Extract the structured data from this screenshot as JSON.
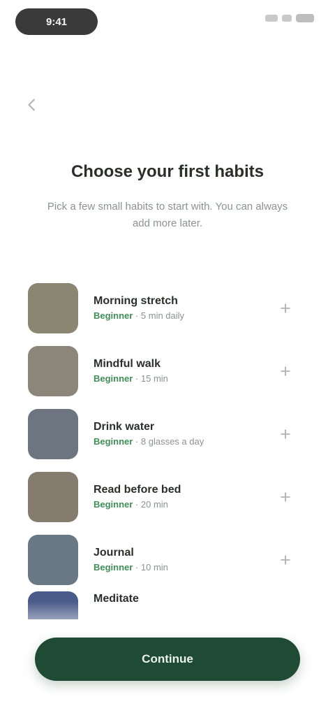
{
  "status_bar": {
    "time": "9:41"
  },
  "header": {
    "title": "Choose your first habits",
    "subtitle": "Pick a few small habits to start with. You can always add more later."
  },
  "habits": [
    {
      "name": "Morning stretch",
      "tag": "Beginner",
      "meta": " · 5 min daily",
      "thumb_color": "#8a8672"
    },
    {
      "name": "Mindful walk",
      "tag": "Beginner",
      "meta": " · 15 min",
      "thumb_color": "#8b8679"
    },
    {
      "name": "Drink water",
      "tag": "Beginner",
      "meta": " · 8 glasses a day",
      "thumb_color": "#6c7580"
    },
    {
      "name": "Read before bed",
      "tag": "Beginner",
      "meta": " · 20 min",
      "thumb_color": "#857b6e"
    },
    {
      "name": "Journal",
      "tag": "Beginner",
      "meta": " · 10 min",
      "thumb_color": "#6a7886"
    },
    {
      "name": "Meditate",
      "tag": "",
      "meta": "",
      "thumb_color": "#4a5a8a"
    }
  ],
  "actions": {
    "continue_label": "Continue"
  },
  "colors": {
    "accent": "#1f4a33",
    "tag": "#3f8f57"
  }
}
